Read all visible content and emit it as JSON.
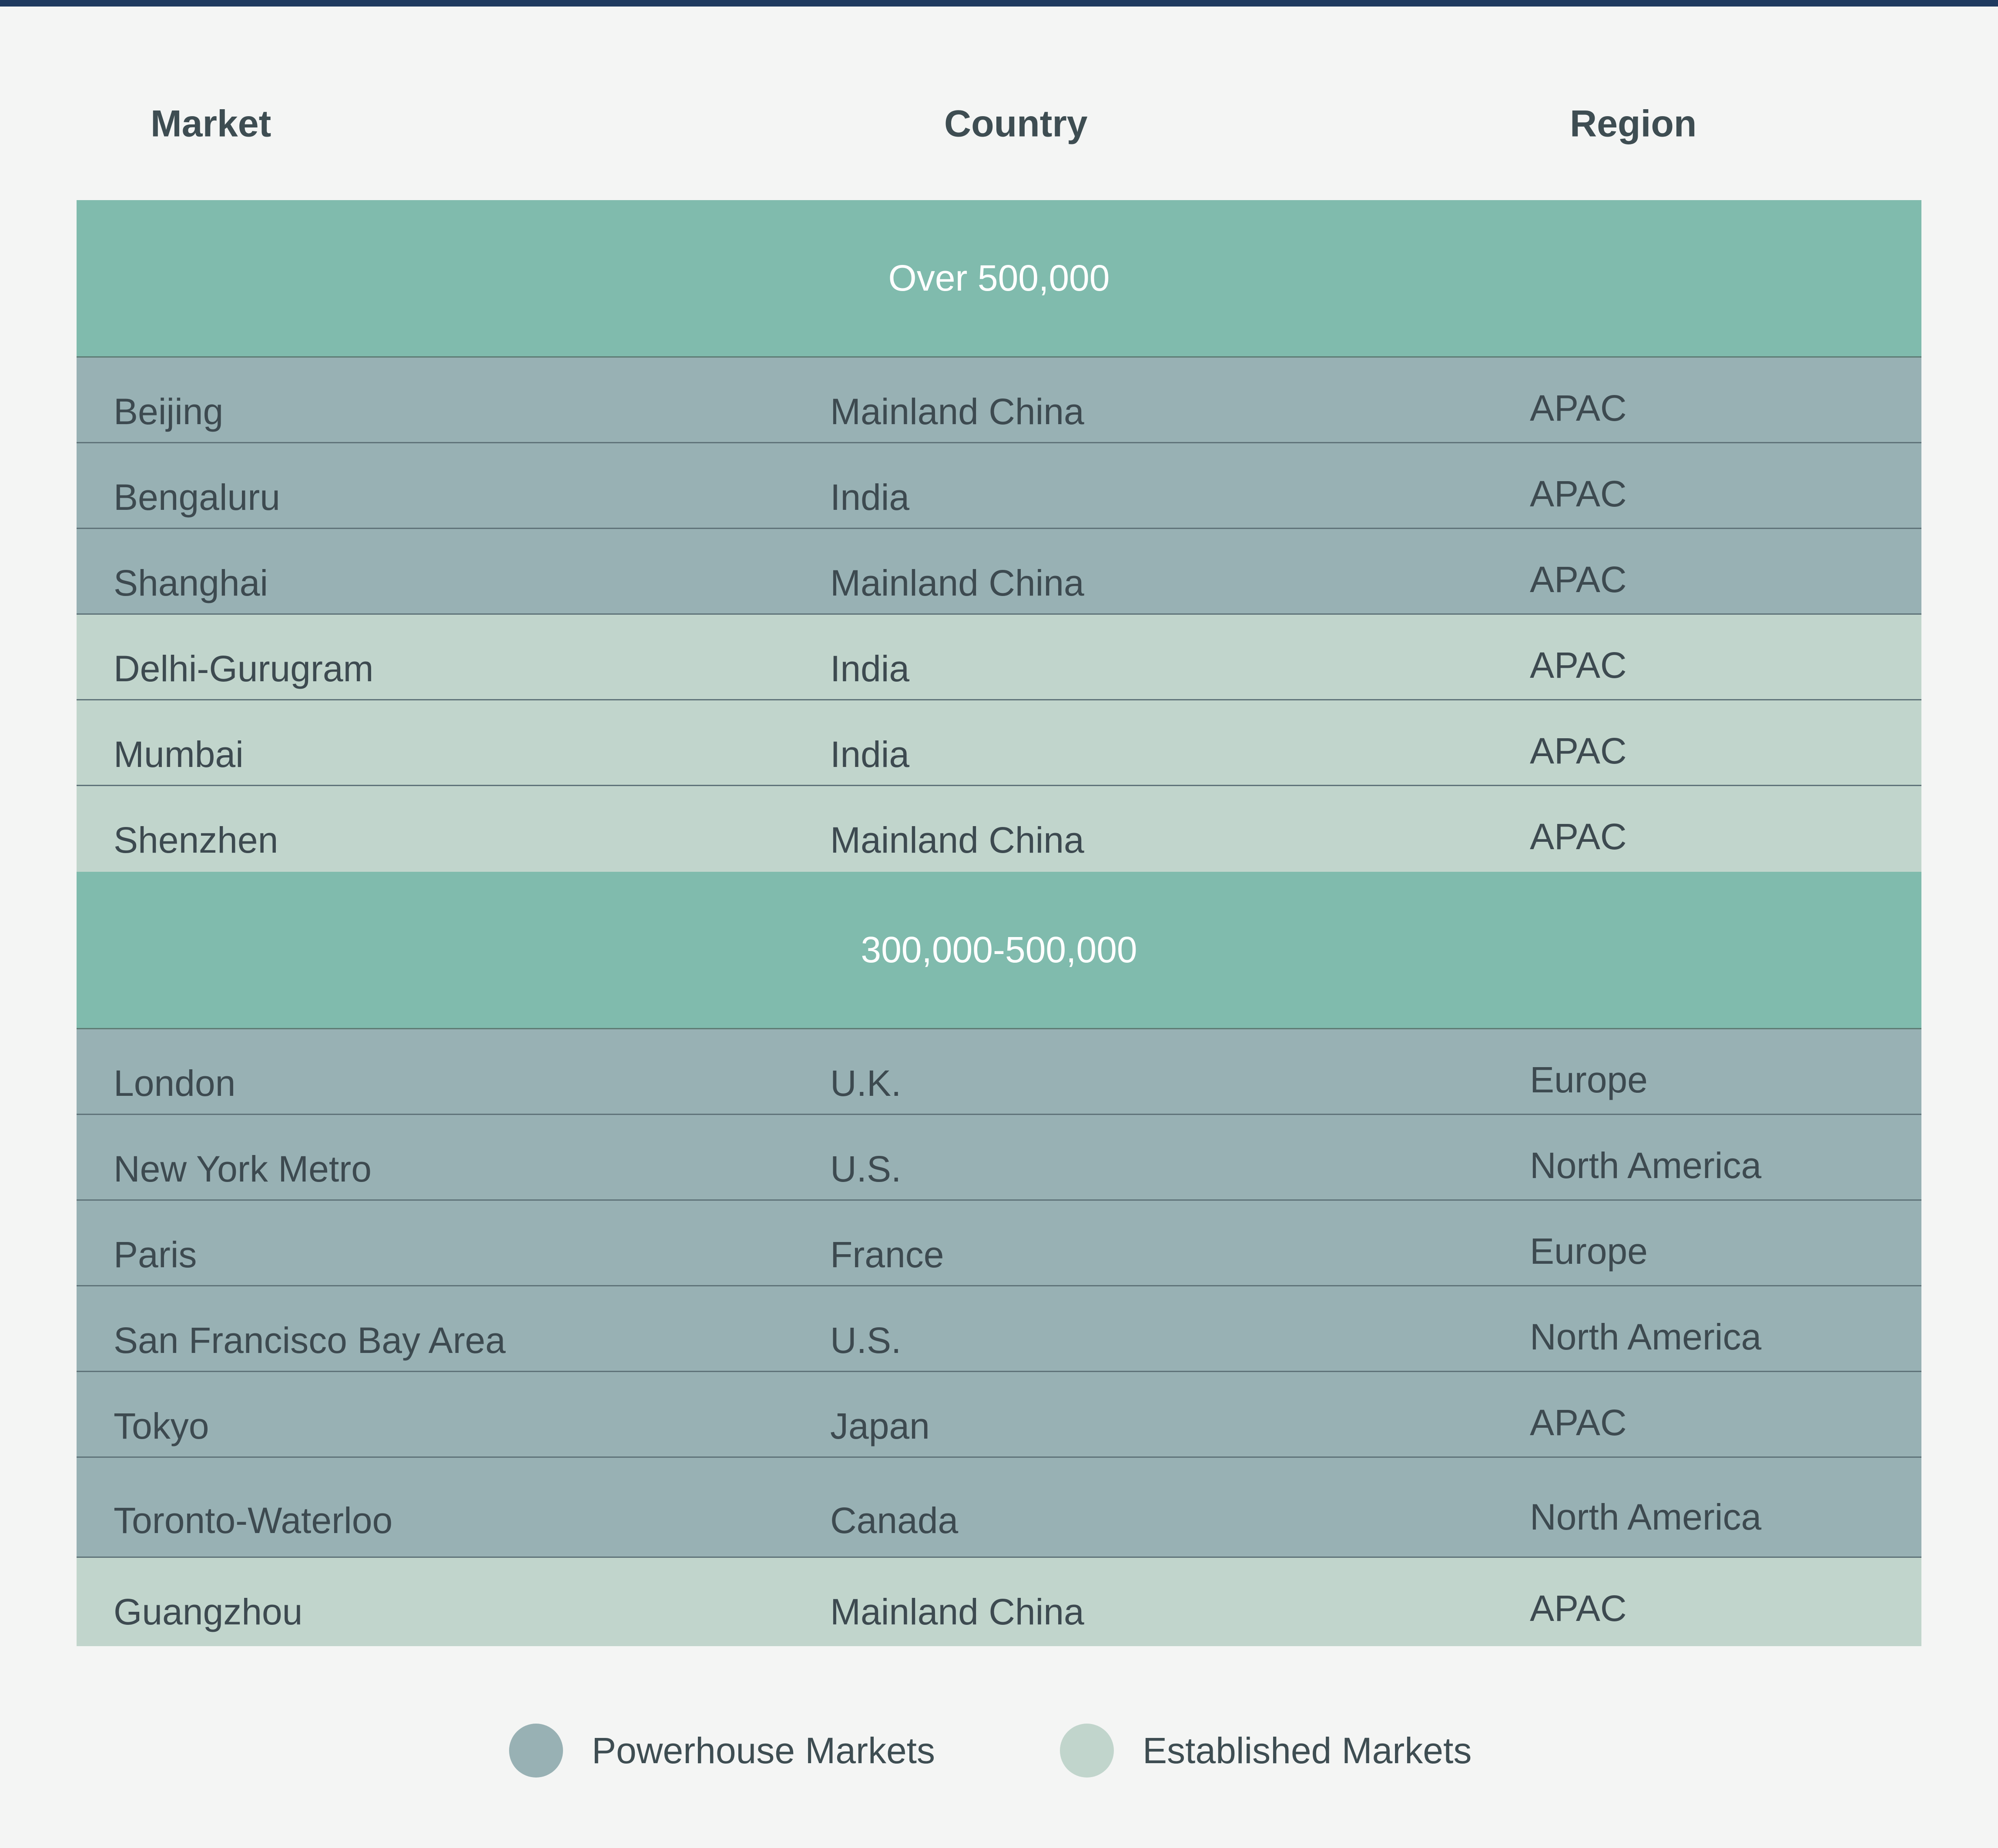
{
  "columns": {
    "market": "Market",
    "country": "Country",
    "region": "Region"
  },
  "colors": {
    "powerhouse": "#98b1b4",
    "established": "#c1d5cc",
    "band": "#80bbad",
    "topbar": "#1f3a5f"
  },
  "groups": [
    {
      "label": "Over 500,000",
      "rows": [
        {
          "market": "Beijing",
          "country": "Mainland China",
          "region": "APAC",
          "tier": "powerhouse"
        },
        {
          "market": "Bengaluru",
          "country": "India",
          "region": "APAC",
          "tier": "powerhouse"
        },
        {
          "market": "Shanghai",
          "country": "Mainland China",
          "region": "APAC",
          "tier": "powerhouse"
        },
        {
          "market": "Delhi-Gurugram",
          "country": "India",
          "region": "APAC",
          "tier": "established"
        },
        {
          "market": "Mumbai",
          "country": "India",
          "region": "APAC",
          "tier": "established"
        },
        {
          "market": "Shenzhen",
          "country": "Mainland China",
          "region": "APAC",
          "tier": "established"
        }
      ]
    },
    {
      "label": "300,000-500,000",
      "rows": [
        {
          "market": "London",
          "country": "U.K.",
          "region": "Europe",
          "tier": "powerhouse"
        },
        {
          "market": "New York Metro",
          "country": "U.S.",
          "region": "North America",
          "tier": "powerhouse"
        },
        {
          "market": "Paris",
          "country": "France",
          "region": "Europe",
          "tier": "powerhouse"
        },
        {
          "market": "San Francisco Bay Area",
          "country": "U.S.",
          "region": "North America",
          "tier": "powerhouse"
        },
        {
          "market": "Tokyo",
          "country": "Japan",
          "region": "APAC",
          "tier": "powerhouse"
        },
        {
          "market": "Toronto-Waterloo",
          "country": "Canada",
          "region": "North America",
          "tier": "powerhouse"
        },
        {
          "market": "Guangzhou",
          "country": "Mainland China",
          "region": "APAC",
          "tier": "established"
        }
      ]
    }
  ],
  "legend": {
    "powerhouse": "Powerhouse Markets",
    "established": "Established Markets"
  }
}
